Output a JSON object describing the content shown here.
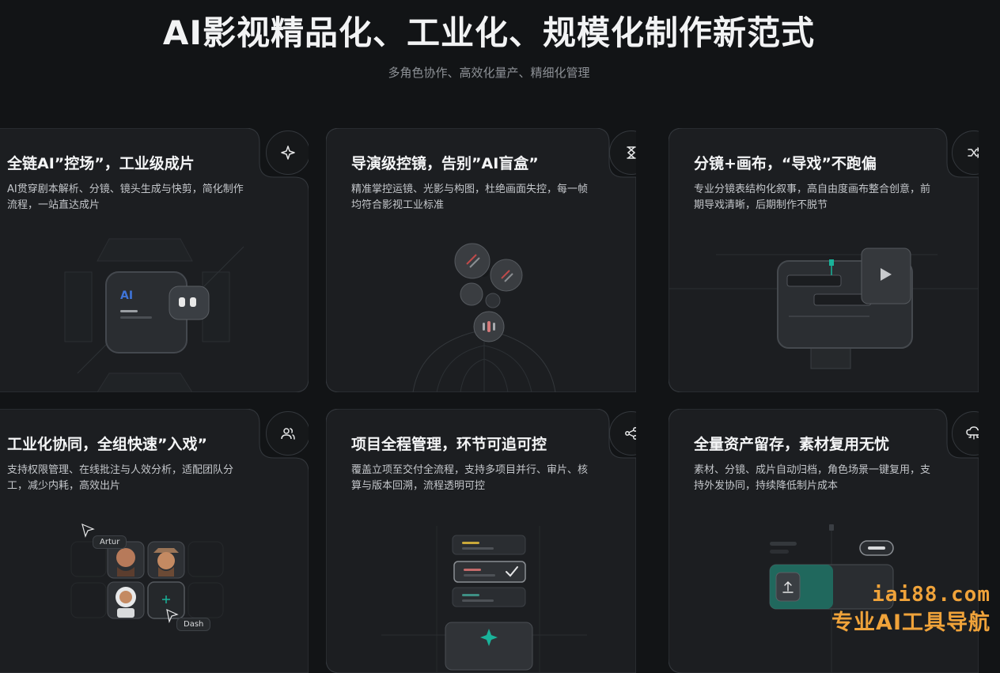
{
  "hero": {
    "title": "AI影视精品化、工业化、规模化制作新范式",
    "subtitle": "多角色协作、高效化量产、精细化管理"
  },
  "cards": [
    {
      "title": "全链AI”控场”，工业级成片",
      "desc": "AI贯穿剧本解析、分镜、镜头生成与快剪，简化制作流程，一站直达成片",
      "icon": "sparkle-icon",
      "badge": "AI"
    },
    {
      "title": "导演级控镜，告别”AI盲盒”",
      "desc": "精准掌控运镜、光影与构图，杜绝画面失控，每一帧均符合影视工业标准",
      "icon": "hourglass-icon"
    },
    {
      "title": "分镜+画布，“导戏”不跑偏",
      "desc": "专业分镜表结构化叙事，高自由度画布整合创意，前期导戏清晰，后期制作不脱节",
      "icon": "shuffle-icon"
    },
    {
      "title": "工业化协同，全组快速”入戏”",
      "desc": "支持权限管理、在线批注与人效分析，适配团队分工，减少内耗，高效出片",
      "icon": "users-icon",
      "cursor_tags": [
        "Artur",
        "Dash"
      ]
    },
    {
      "title": "项目全程管理，环节可追可控",
      "desc": "覆盖立项至交付全流程，支持多项目并行、审片、核算与版本回溯，流程透明可控",
      "icon": "share-nodes-icon"
    },
    {
      "title": "全量资产留存，素材复用无忧",
      "desc": "素材、分镜、成片自动归档，角色场景一键复用，支持外发协同，持续降低制片成本",
      "icon": "cloud-network-icon"
    }
  ],
  "watermark": {
    "url": "iai88.com",
    "slogan": "专业AI工具导航"
  },
  "colors": {
    "background": "#121416",
    "card": "#1c1e21",
    "border": "#34383d",
    "accent": "#19b39a",
    "watermark": "#f0a33a"
  }
}
